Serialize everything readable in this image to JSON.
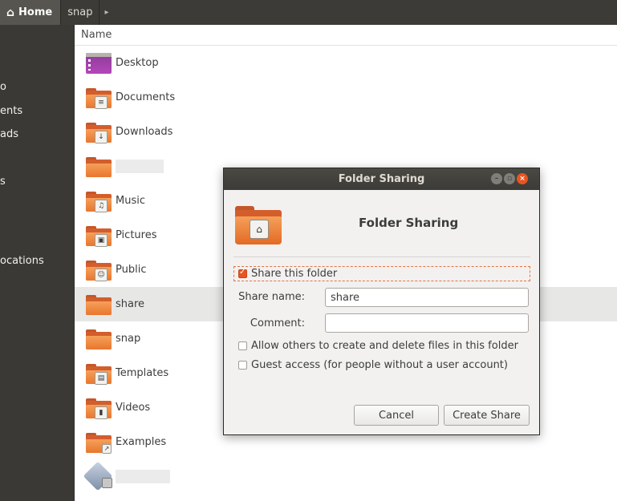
{
  "pathbar": {
    "home_label": "Home",
    "current_label": "snap",
    "arrow": "▸"
  },
  "sidebar": {
    "items": [
      "o",
      "ents",
      "ads",
      "s",
      "ocations"
    ]
  },
  "filelist": {
    "column_name": "Name",
    "rows": [
      {
        "name": "Desktop",
        "icon": "desktop-folder-icon"
      },
      {
        "name": "Documents",
        "icon": "documents-folder-icon"
      },
      {
        "name": "Downloads",
        "icon": "downloads-folder-icon"
      },
      {
        "name": "",
        "icon": "folder-icon"
      },
      {
        "name": "Music",
        "icon": "music-folder-icon"
      },
      {
        "name": "Pictures",
        "icon": "pictures-folder-icon"
      },
      {
        "name": "Public",
        "icon": "public-folder-icon"
      },
      {
        "name": "share",
        "icon": "folder-icon"
      },
      {
        "name": "snap",
        "icon": "folder-icon"
      },
      {
        "name": "Templates",
        "icon": "templates-folder-icon"
      },
      {
        "name": "Videos",
        "icon": "videos-folder-icon"
      },
      {
        "name": "Examples",
        "icon": "examples-folder-icon"
      },
      {
        "name": "",
        "icon": "drive-icon"
      }
    ]
  },
  "dialog": {
    "window_title": "Folder Sharing",
    "heading": "Folder Sharing",
    "share_checkbox_label": "Share this folder",
    "share_checked": true,
    "share_name_label": "Share name:",
    "share_name_value": "share",
    "comment_label": "Comment:",
    "comment_value": "",
    "allow_others_label": "Allow others to create and delete files in this folder",
    "allow_others_checked": false,
    "guest_label": "Guest access (for people without a user account)",
    "guest_checked": false,
    "cancel_label": "Cancel",
    "create_label": "Create Share"
  },
  "colors": {
    "accent": "#e95420",
    "titlebar": "#3c3b37",
    "sidebar": "#3a3935"
  }
}
